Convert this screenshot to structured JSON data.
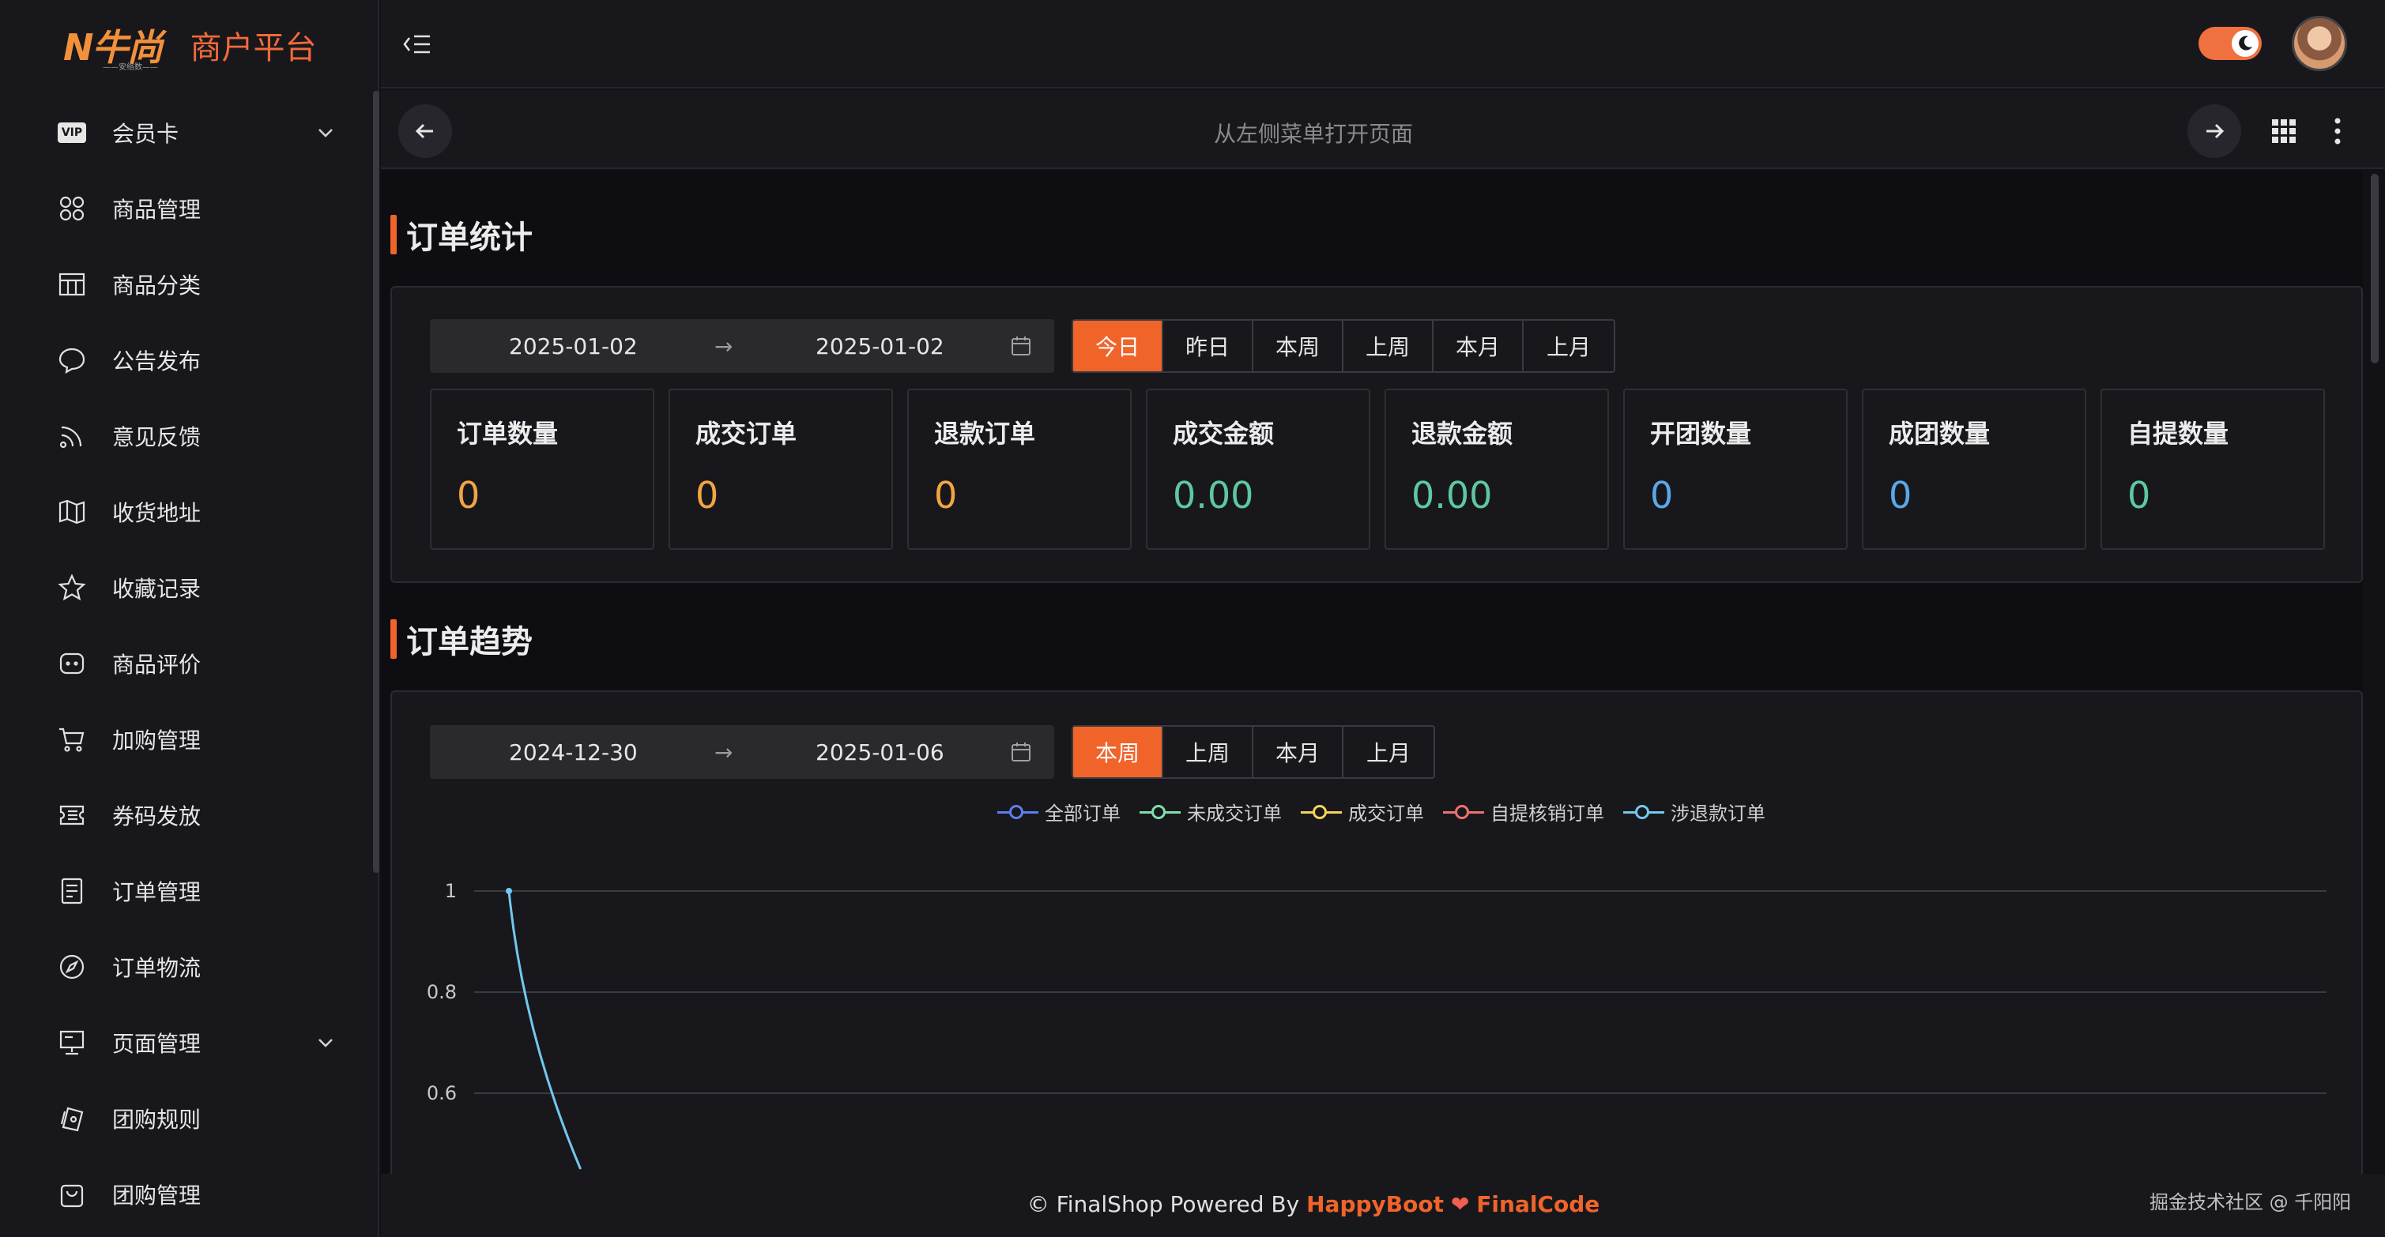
{
  "brand": {
    "logo_text": "N牛尚",
    "logo_sub": "——安络数——",
    "title": "商户平台"
  },
  "sidebar": {
    "items": [
      {
        "label": "会员卡",
        "icon": "vip-icon",
        "expandable": true
      },
      {
        "label": "商品管理",
        "icon": "apps-icon"
      },
      {
        "label": "商品分类",
        "icon": "table-icon"
      },
      {
        "label": "公告发布",
        "icon": "chat-bubble-icon"
      },
      {
        "label": "意见反馈",
        "icon": "rss-icon"
      },
      {
        "label": "收货地址",
        "icon": "map-icon"
      },
      {
        "label": "收藏记录",
        "icon": "star-icon"
      },
      {
        "label": "商品评价",
        "icon": "comment-icon"
      },
      {
        "label": "加购管理",
        "icon": "cart-icon"
      },
      {
        "label": "券码发放",
        "icon": "ticket-icon"
      },
      {
        "label": "订单管理",
        "icon": "document-icon"
      },
      {
        "label": "订单物流",
        "icon": "compass-icon"
      },
      {
        "label": "页面管理",
        "icon": "presentation-icon",
        "expandable": true
      },
      {
        "label": "团购规则",
        "icon": "cards-icon"
      },
      {
        "label": "团购管理",
        "icon": "bag-icon"
      }
    ]
  },
  "tabbar": {
    "center_text": "从左侧菜单打开页面"
  },
  "order_stats": {
    "title": "订单统计",
    "date_start": "2025-01-02",
    "date_end": "2025-01-02",
    "arrow": "→",
    "ranges": [
      "今日",
      "昨日",
      "本周",
      "上周",
      "本月",
      "上月"
    ],
    "active_range": 0,
    "cards": [
      {
        "label": "订单数量",
        "value": "0",
        "color": "#f2a540"
      },
      {
        "label": "成交订单",
        "value": "0",
        "color": "#f2a540"
      },
      {
        "label": "退款订单",
        "value": "0",
        "color": "#f2a540"
      },
      {
        "label": "成交金额",
        "value": "0.00",
        "color": "#5ec8a0"
      },
      {
        "label": "退款金额",
        "value": "0.00",
        "color": "#5ec8a0"
      },
      {
        "label": "开团数量",
        "value": "0",
        "color": "#5aa8e8"
      },
      {
        "label": "成团数量",
        "value": "0",
        "color": "#5aa8e8"
      },
      {
        "label": "自提数量",
        "value": "0",
        "color": "#5ec8a0"
      }
    ]
  },
  "order_trend": {
    "title": "订单趋势",
    "date_start": "2024-12-30",
    "date_end": "2025-01-06",
    "arrow": "→",
    "ranges": [
      "本周",
      "上周",
      "本月",
      "上月"
    ],
    "active_range": 0
  },
  "chart_data": {
    "type": "line",
    "series": [
      {
        "name": "全部订单",
        "color": "#5b7ef0"
      },
      {
        "name": "未成交订单",
        "color": "#7ee0a8"
      },
      {
        "name": "成交订单",
        "color": "#f5d35a"
      },
      {
        "name": "自提核销订单",
        "color": "#f07070"
      },
      {
        "name": "涉退款订单",
        "color": "#72c8f0",
        "points": [
          [
            0,
            1
          ],
          [
            0.58,
            0.45
          ]
        ]
      }
    ],
    "y_ticks": [
      "1",
      "0.8",
      "0.6"
    ],
    "y_tick_values": [
      1,
      0.8,
      0.6
    ],
    "ylim": [
      0.45,
      1
    ],
    "x_count": 16,
    "grid": true,
    "legend_position": "top"
  },
  "footer": {
    "prefix": "© FinalShop Powered By ",
    "link1": "HappyBoot",
    "heart": "❤",
    "link2": "FinalCode",
    "right_text": "掘金技术社区 @ 千阳阳"
  }
}
